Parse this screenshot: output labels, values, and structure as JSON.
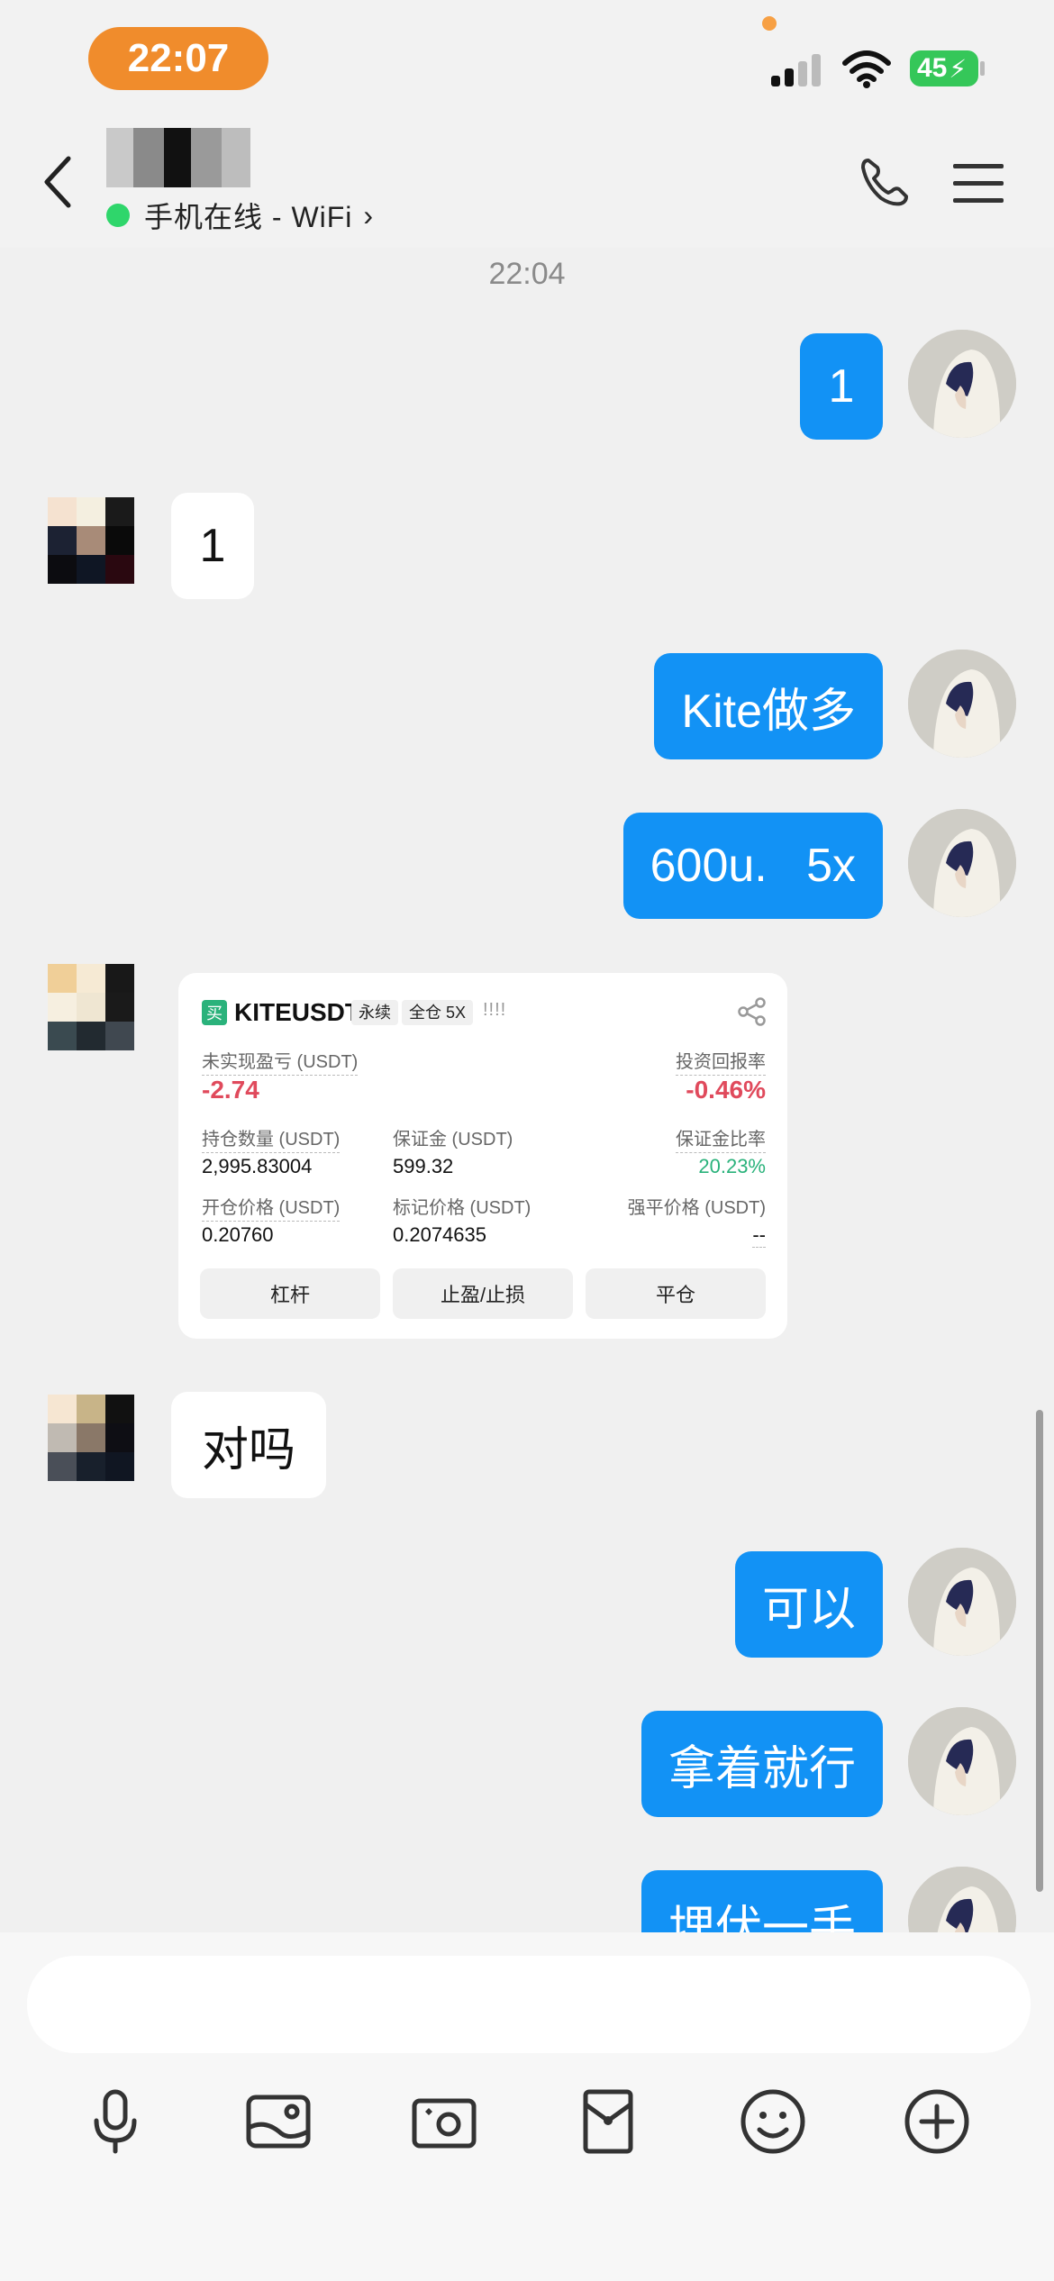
{
  "status_bar": {
    "time": "22:07",
    "battery": "45"
  },
  "header": {
    "status_text": "手机在线 - WiFi",
    "chevron": "›",
    "back_icon": "chevron-left-icon",
    "call_icon": "phone-icon",
    "menu_icon": "hamburger-menu-icon"
  },
  "chat": {
    "timestamp": "22:04",
    "messages": [
      {
        "from": "me",
        "text": "1"
      },
      {
        "from": "them",
        "text": "1"
      },
      {
        "from": "me",
        "text": "Kite做多"
      },
      {
        "from": "me",
        "text": "600u.   5x"
      },
      {
        "from": "them",
        "type": "trade_card"
      },
      {
        "from": "them",
        "text": "对吗"
      },
      {
        "from": "me",
        "text": "可以"
      },
      {
        "from": "me",
        "text": "拿着就行"
      },
      {
        "from": "me",
        "text": "埋伏一手"
      }
    ]
  },
  "trade_card": {
    "side": "买",
    "symbol": "KITEUSDT",
    "tag_perp": "永续",
    "tag_margin": "全仓 5X",
    "bars": "!!!!",
    "unrealized_label": "未实现盈亏 (USDT)",
    "unrealized_value": "-2.74",
    "roi_label": "投资回报率",
    "roi_value": "-0.46%",
    "position_label": "持仓数量 (USDT)",
    "position_value": "2,995.83004",
    "margin_label": "保证金 (USDT)",
    "margin_value": "599.32",
    "margin_ratio_label": "保证金比率",
    "margin_ratio_value": "20.23%",
    "entry_label": "开仓价格 (USDT)",
    "entry_value": "0.20760",
    "mark_label": "标记价格 (USDT)",
    "mark_value": "0.2074635",
    "liq_label": "强平价格 (USDT)",
    "liq_value": "--",
    "btn_leverage": "杠杆",
    "btn_tpsl": "止盈/止损",
    "btn_close": "平仓"
  },
  "input_bar": {
    "placeholder": "",
    "tools": [
      "microphone-icon",
      "image-icon",
      "camera-icon",
      "red-packet-icon",
      "emoji-icon",
      "plus-icon"
    ]
  },
  "colors": {
    "my_bubble": "#1292f5",
    "online": "#2fd66b",
    "time_pill": "#f08c2c",
    "loss": "#e04a5c",
    "gain": "#2ab27b"
  }
}
